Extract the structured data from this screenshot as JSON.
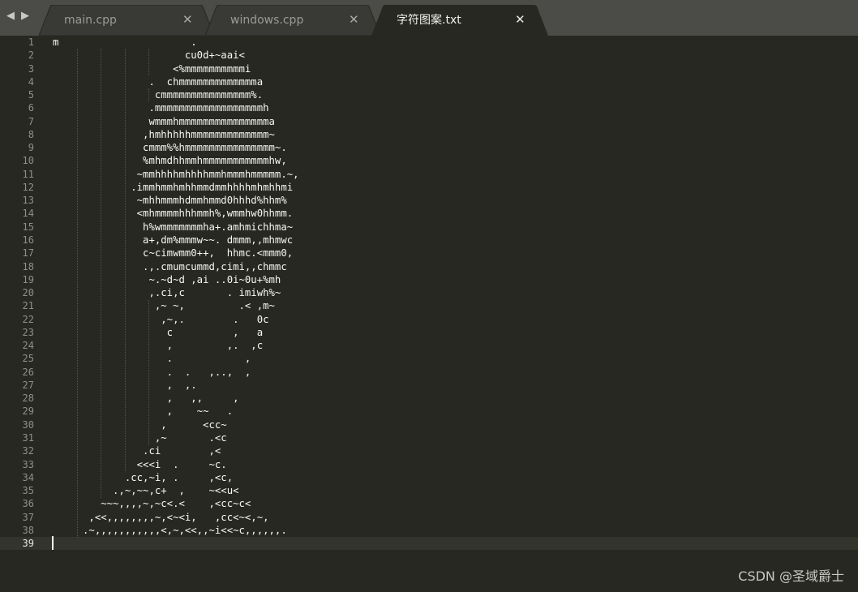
{
  "tabs": [
    {
      "label": "main.cpp",
      "active": false
    },
    {
      "label": "windows.cpp",
      "active": false
    },
    {
      "label": "字符图案.txt",
      "active": true
    }
  ],
  "icons": {
    "nav_back": "◀",
    "nav_forward": "▶",
    "close": "✕"
  },
  "editor": {
    "current_line": "39",
    "line_numbers": [
      "1",
      "2",
      "3",
      "4",
      "5",
      "6",
      "7",
      "8",
      "9",
      "10",
      "11",
      "12",
      "13",
      "14",
      "15",
      "16",
      "17",
      "18",
      "19",
      "20",
      "21",
      "22",
      "23",
      "24",
      "25",
      "26",
      "27",
      "28",
      "29",
      "30",
      "31",
      "32",
      "33",
      "34",
      "35",
      "36",
      "37",
      "38",
      "39"
    ],
    "lines": [
      "m                      .",
      "                      cu0d+~aai<",
      "                    <%mmmmmmmmmmi",
      "                .  chmmmmmmmmmmmmma",
      "                 cmmmmmmmmmmmmmmm%.",
      "                .mmmmmmmmmmmmmmmmmmh",
      "                wmmmhmmmmmmmmmmmmmmma",
      "               ,hmhhhhhmmmmmmmmmmmmm~",
      "               cmmm%%hmmmmmmmmmmmmmmm~.",
      "               %mhmdhhmmhmmmmmmmmmmmhw,",
      "              ~mmhhhhmhhhhmmhmmmhmmmmm.~,",
      "             .immhmmhmhhmmdmmhhhhmhmhhmi",
      "              ~mhhmmmhdmmhmmd0hhhd%hhm%",
      "              <mhmmmmhhhmmh%,wmmhw0hhmm.",
      "               h%wmmmmmmmha+.amhmichhma~",
      "               a+,dm%mmmw~~. dmmm,,mhmwc",
      "               c~cimwmm0++,  hhmc.<mmm0,",
      "               .,.cmumcummd,cimi,,chmmc",
      "                ~.~d~d ,ai ..0i~0u+%mh",
      "                ,.ci,c       . imiwh%~",
      "                 ,~ ~,         .< ,m~",
      "                  ,~,.        .   0c",
      "                   c          ,   a",
      "                   ,         ,.  ,c",
      "                   .            ,",
      "                   .  .   ,..,  ,",
      "                   ,  ,.",
      "                   ,   ,,     ,",
      "                   ,    ~~   .",
      "                  ,      <cc~",
      "                 ,~       .<c",
      "               .ci        ,<",
      "              <<<i  .     ~c.",
      "            .cc,~i, .     ,<c,",
      "          .,~,~~,c+  ,    ~<<u<",
      "        ~~~,,,,~,~c<.<    ,<cc~c<",
      "      ,<<,,,,,,,,~,<~<i,   ,cc<~<,~,",
      "     .~,,,,,,,,,,,<,~,<<,,~i<<~c,,,,,,.",
      ""
    ]
  },
  "watermark": "CSDN @圣域爵士"
}
